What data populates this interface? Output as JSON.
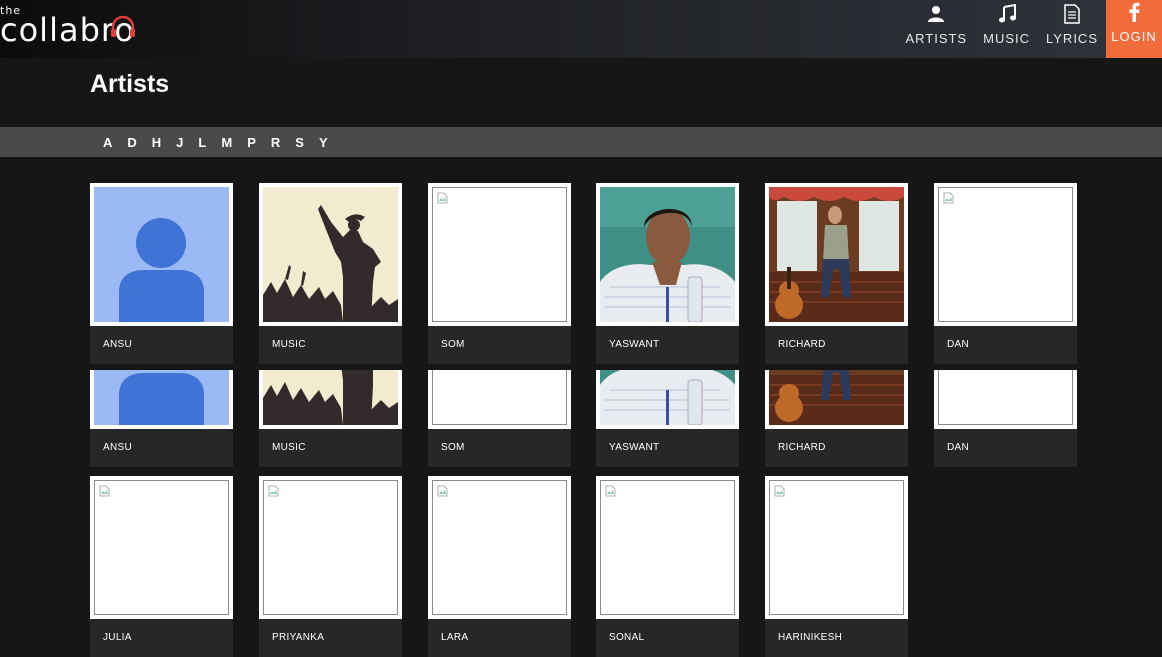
{
  "brand": {
    "prefix": "the",
    "name": "collabro"
  },
  "nav": [
    {
      "label": "ARTISTS",
      "icon": "person-icon"
    },
    {
      "label": "MUSIC",
      "icon": "music-note-icon"
    },
    {
      "label": "LYRICS",
      "icon": "document-icon"
    },
    {
      "label": "LOGIN",
      "icon": "facebook-icon"
    }
  ],
  "colors": {
    "accent": "#f26b3b",
    "alpha_bar": "#4a4a4a",
    "background": "#161616",
    "caption_bg": "#272727"
  },
  "page": {
    "title": "Artists"
  },
  "alphabet": [
    "A",
    "D",
    "H",
    "J",
    "L",
    "M",
    "P",
    "R",
    "S",
    "Y"
  ],
  "artists_row1": [
    "ANSU",
    "MUSIC",
    "SOM",
    "YASWANT",
    "RICHARD",
    "DAN"
  ],
  "artists_row2": [
    "ANSU",
    "MUSIC",
    "SOM",
    "YASWANT",
    "RICHARD",
    "DAN"
  ],
  "artists_row3": [
    "JULIA",
    "PRIYANKA",
    "LARA",
    "SONAL",
    "HARINIKESH"
  ]
}
